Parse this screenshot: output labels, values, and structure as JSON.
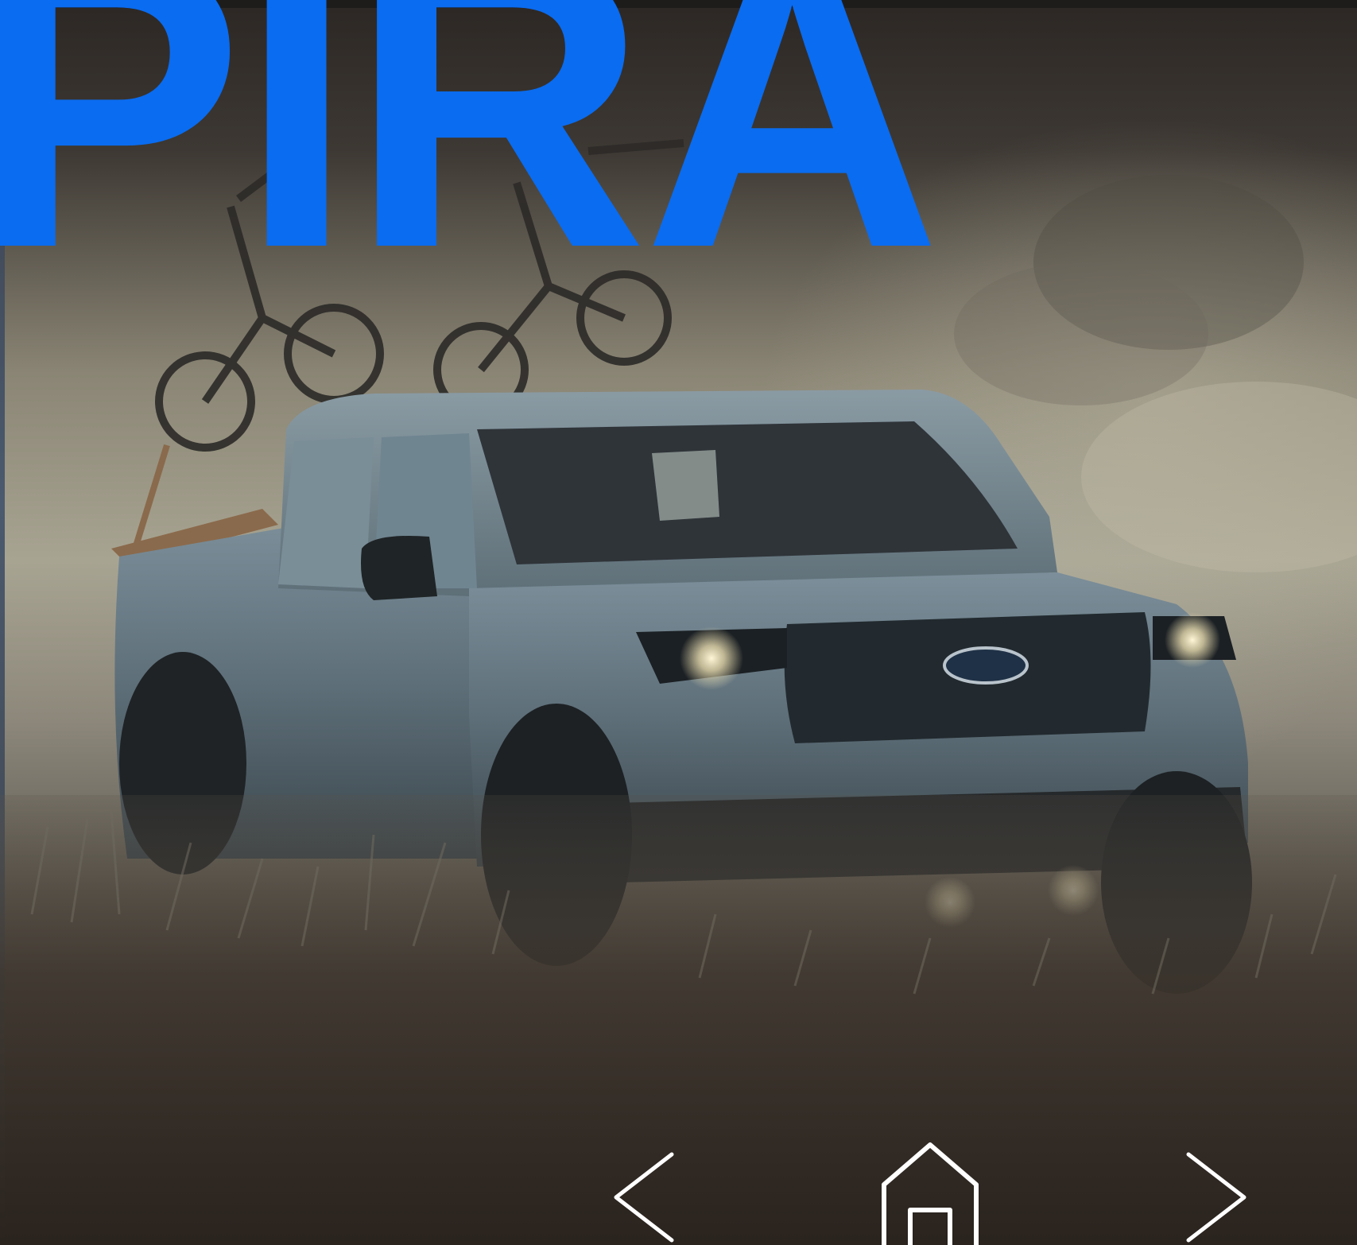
{
  "hero": {
    "title": "PIRA",
    "title_color": "#0a6cf0",
    "image": "ford-pickup-with-bikes-in-field"
  },
  "nav": {
    "prev_icon": "chevron-left-icon",
    "home_icon": "home-icon",
    "next_icon": "chevron-right-icon",
    "icon_color": "#ffffff"
  }
}
